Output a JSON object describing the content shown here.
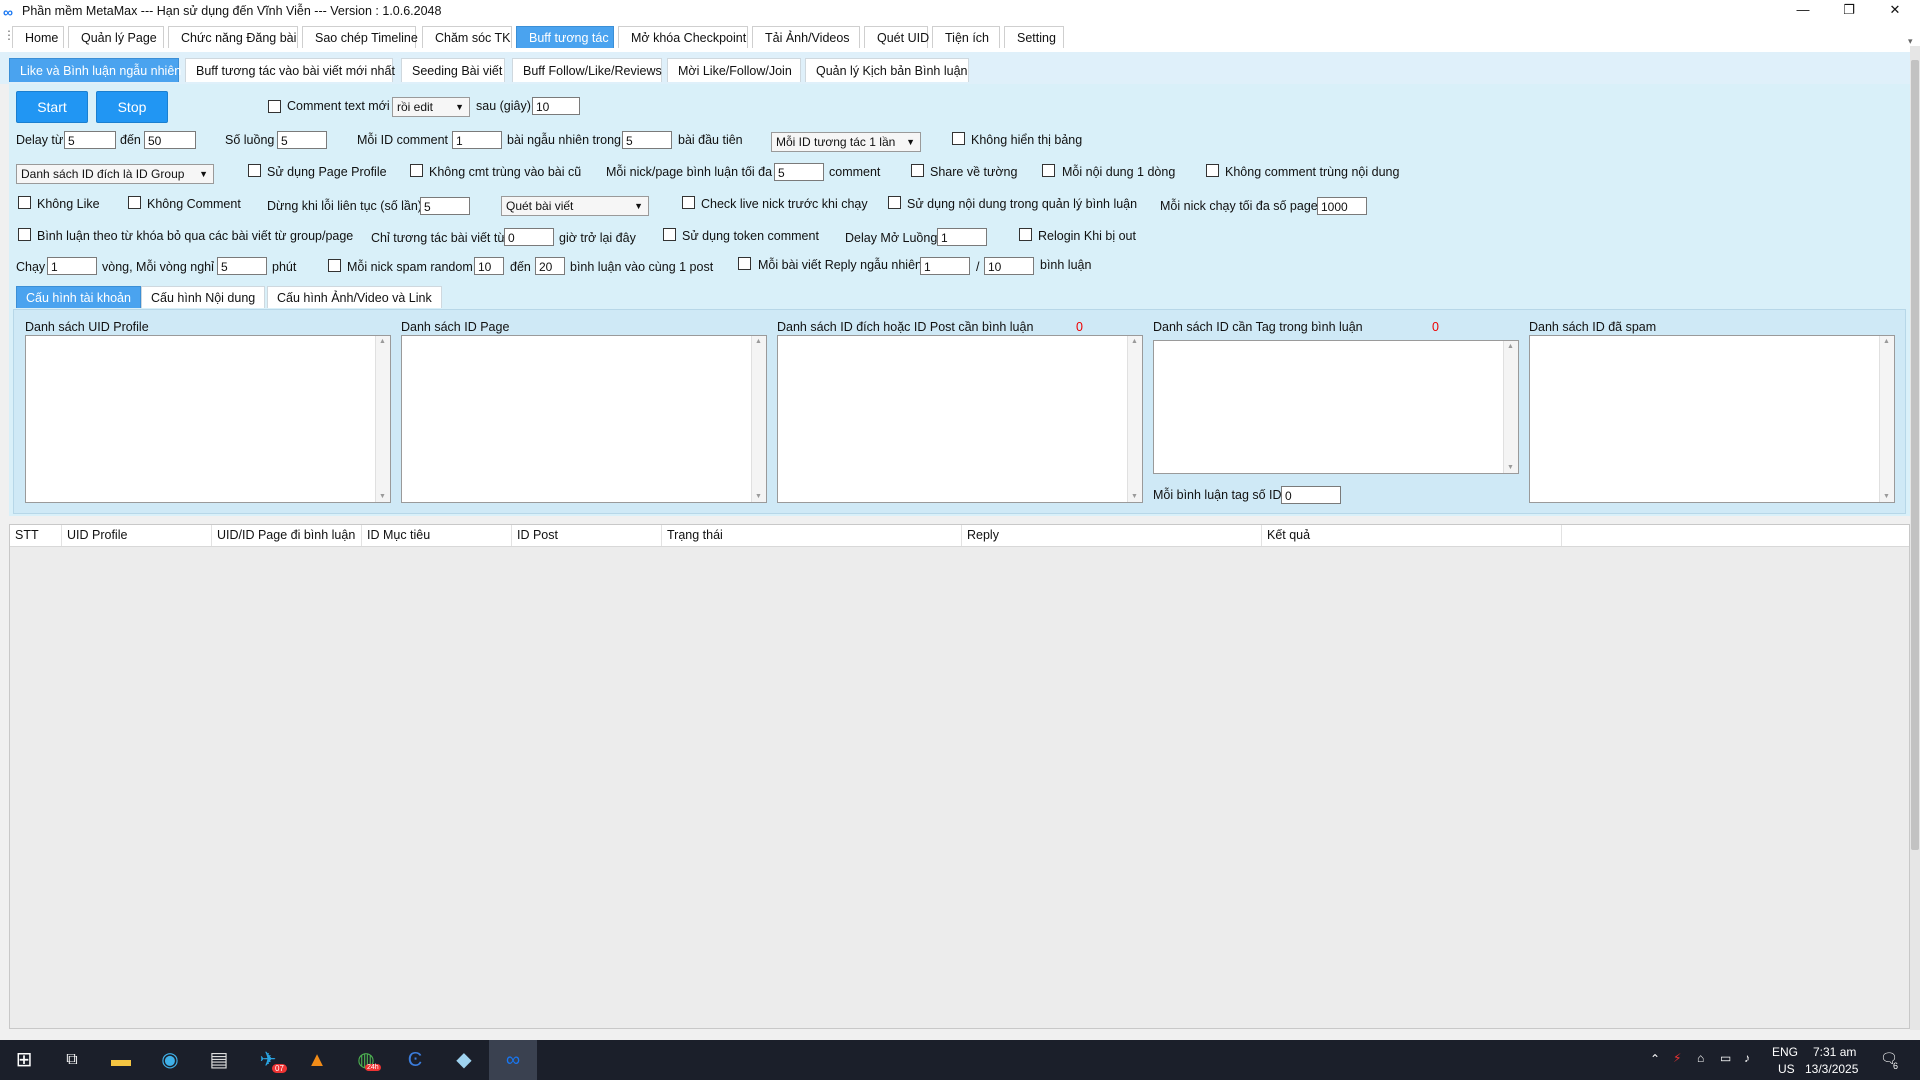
{
  "window": {
    "title": "Phần mềm MetaMax --- Hạn sử dụng đến Vĩnh Viễn --- Version : 1.0.6.2048",
    "logo_icon": "meta-infinity-icon"
  },
  "main_tabs": [
    "Home",
    "Quản lý Page",
    "Chức năng Đăng bài",
    "Sao chép Timeline",
    "Chăm sóc TK",
    "Buff tương tác",
    "Mở khóa Checkpoint",
    "Tải Ảnh/Videos",
    "Quét UID",
    "Tiện ích",
    "Setting"
  ],
  "main_tab_active": "Buff tương tác",
  "sub_tabs": [
    "Like và Bình luận ngẫu nhiên",
    "Buff tương tác vào bài viết mới nhất",
    "Seeding Bài viết",
    "Buff Follow/Like/Reviews",
    "Mời Like/Follow/Join",
    "Quản lý Kịch bản Bình luận"
  ],
  "sub_tab_active": "Like và Bình luận ngẫu nhiên",
  "controls": {
    "start": "Start",
    "stop": "Stop",
    "comment_text_moi": "Comment text mới",
    "roi_edit": "rồi edit",
    "sau_giay": "sau (giây)",
    "sau_giay_value": "10",
    "delay_tu": "Delay từ",
    "delay_tu_value": "5",
    "den": "đến",
    "delay_den_value": "50",
    "so_luong": "Số luồng",
    "so_luong_value": "5",
    "moi_id_comment": "Mỗi ID comment",
    "moi_id_comment_value": "1",
    "bai_ngau_nhien_trong": "bài ngẫu nhiên trong",
    "bai_ngau_nhien_value": "5",
    "bai_dau_tien": "bài đầu tiên",
    "moi_id_tuong_tac": "Mỗi ID tương tác 1 lần",
    "khong_hien_thi_bang": "Không hiển thị bảng",
    "danh_sach_id_dich": "Danh sách ID đích là ID Group",
    "su_dung_page_profile": "Sử dụng Page Profile",
    "khong_cmt_trung": "Không cmt trùng vào bài cũ",
    "moi_nick_page_bl": "Mỗi nick/page bình luận tối đa",
    "moi_nick_page_bl_value": "5",
    "comment": "comment",
    "share_ve_tuong": "Share về tường",
    "moi_noi_dung_1_dong": "Mỗi nội dung 1 dòng",
    "khong_comment_trung_nd": "Không comment trùng nội dung",
    "khong_like": "Không Like",
    "khong_comment": "Không Comment",
    "dung_khi_loi": "Dừng khi lỗi liên tục (số lần)",
    "dung_khi_loi_value": "5",
    "quet_bai_viet": "Quét bài viết",
    "check_live_nick": "Check live nick trước khi chạy",
    "su_dung_nd_quan_ly": "Sử dụng nội dung trong quản lý bình luận",
    "moi_nick_chay_toi_da": "Mỗi nick chạy tối đa số page",
    "moi_nick_chay_toi_da_value": "1000",
    "binh_luan_theo_tu_khoa": "Bình luận theo từ khóa bỏ qua các bài viết từ group/page",
    "chi_tuong_tac_bai_viet_tu": "Chỉ tương tác bài viết từ",
    "chi_tuong_tac_value": "0",
    "gio_tro_lai_day": "giờ trở lại đây",
    "su_dung_token_comment": "Sử dụng token comment",
    "delay_mo_luong": "Delay Mở Luồng",
    "delay_mo_luong_value": "1",
    "relogin_khi_bi_out": "Relogin Khi bị out",
    "chay": "Chạy",
    "chay_value": "1",
    "vong_moi_vong_nghi": "vòng, Mỗi vòng nghỉ",
    "vong_nghi_value": "5",
    "phut": "phút",
    "moi_nick_spam_random": "Mỗi nick spam random",
    "spam_from_value": "10",
    "spam_den": "đến",
    "spam_to_value": "20",
    "binh_luan_vao_cung_1_post": "bình luận vào cùng 1 post",
    "moi_bai_viet_reply": "Mỗi bài viết Reply ngẫu nhiên",
    "reply_from_value": "1",
    "slash": "/",
    "reply_to_value": "10",
    "binh_luan": "bình luận"
  },
  "config_tabs": [
    "Cấu hình tài khoản",
    "Cấu hình Nội dung",
    "Cấu hình Ảnh/Video và Link"
  ],
  "config_tab_active": "Cấu hình tài khoản",
  "lists": {
    "uid_profile": "Danh sách UID Profile",
    "id_page": "Danh sách ID Page",
    "id_dich": "Danh sách ID đích hoặc ID Post cần bình luận",
    "id_dich_count": "0",
    "id_tag": "Danh sách ID cần Tag trong bình luận",
    "id_tag_count": "0",
    "id_spam": "Danh sách ID đã spam",
    "moi_bl_tag_so_id": "Mỗi bình luận tag số ID",
    "moi_bl_tag_so_id_value": "0"
  },
  "grid_columns": [
    "STT",
    "UID Profile",
    "UID/ID Page đi bình luận",
    "ID Mục tiêu",
    "ID Post",
    "Trạng thái",
    "Reply",
    "Kết quả"
  ],
  "taskbar": {
    "lang": "ENG",
    "region": "US",
    "time": "7:31 am",
    "date": "13/3/2025",
    "notif_count": "6",
    "badge_07": "07",
    "badge_24h": "24h"
  },
  "colors": {
    "accent": "#4aa3ef",
    "button": "#2196f3",
    "panel": "#d9f0f9",
    "taskbar": "#1b1f2a"
  }
}
